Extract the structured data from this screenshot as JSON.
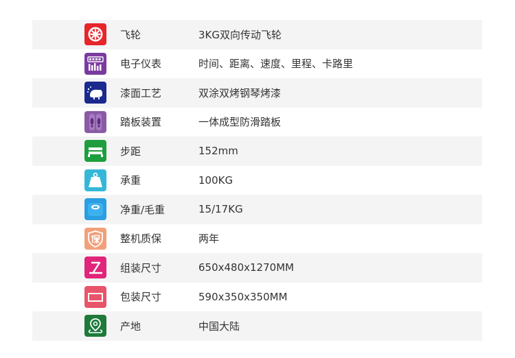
{
  "specs": [
    {
      "label": "飞轮",
      "value": "3KG双向传动飞轮",
      "icon": "flywheel-icon",
      "color": "#e5262b"
    },
    {
      "label": "电子仪表",
      "value": "时间、距离、速度、里程、卡路里",
      "icon": "display-meter-icon",
      "color": "#7b3aa0"
    },
    {
      "label": "漆面工艺",
      "value": "双涂双烤钢琴烤漆",
      "icon": "paint-spray-icon",
      "color": "#1a2a8f"
    },
    {
      "label": "踏板装置",
      "value": "一体成型防滑踏板",
      "icon": "footprint-pedal-icon",
      "color": "#8a5aa6"
    },
    {
      "label": "步距",
      "value": "152mm",
      "icon": "stride-bed-icon",
      "color": "#1e9e3e"
    },
    {
      "label": "承重",
      "value": "100KG",
      "icon": "weight-icon",
      "color": "#35b8d8"
    },
    {
      "label": "净重/毛重",
      "value": " 15/17KG",
      "icon": "scale-icon",
      "color": "#2a9ee0"
    },
    {
      "label": "整机质保",
      "value": "两年",
      "icon": "warranty-shield-icon",
      "color": "#f2a07a"
    },
    {
      "label": "组装尺寸",
      "value": "650x480x1270MM",
      "icon": "assembled-size-icon",
      "color": "#e0257a"
    },
    {
      "label": "包装尺寸",
      "value": "590x350x350MM",
      "icon": "package-size-icon",
      "color": "#e8546a"
    },
    {
      "label": "产地",
      "value": "中国大陆",
      "icon": "location-pin-icon",
      "color": "#1e7a3a"
    }
  ]
}
